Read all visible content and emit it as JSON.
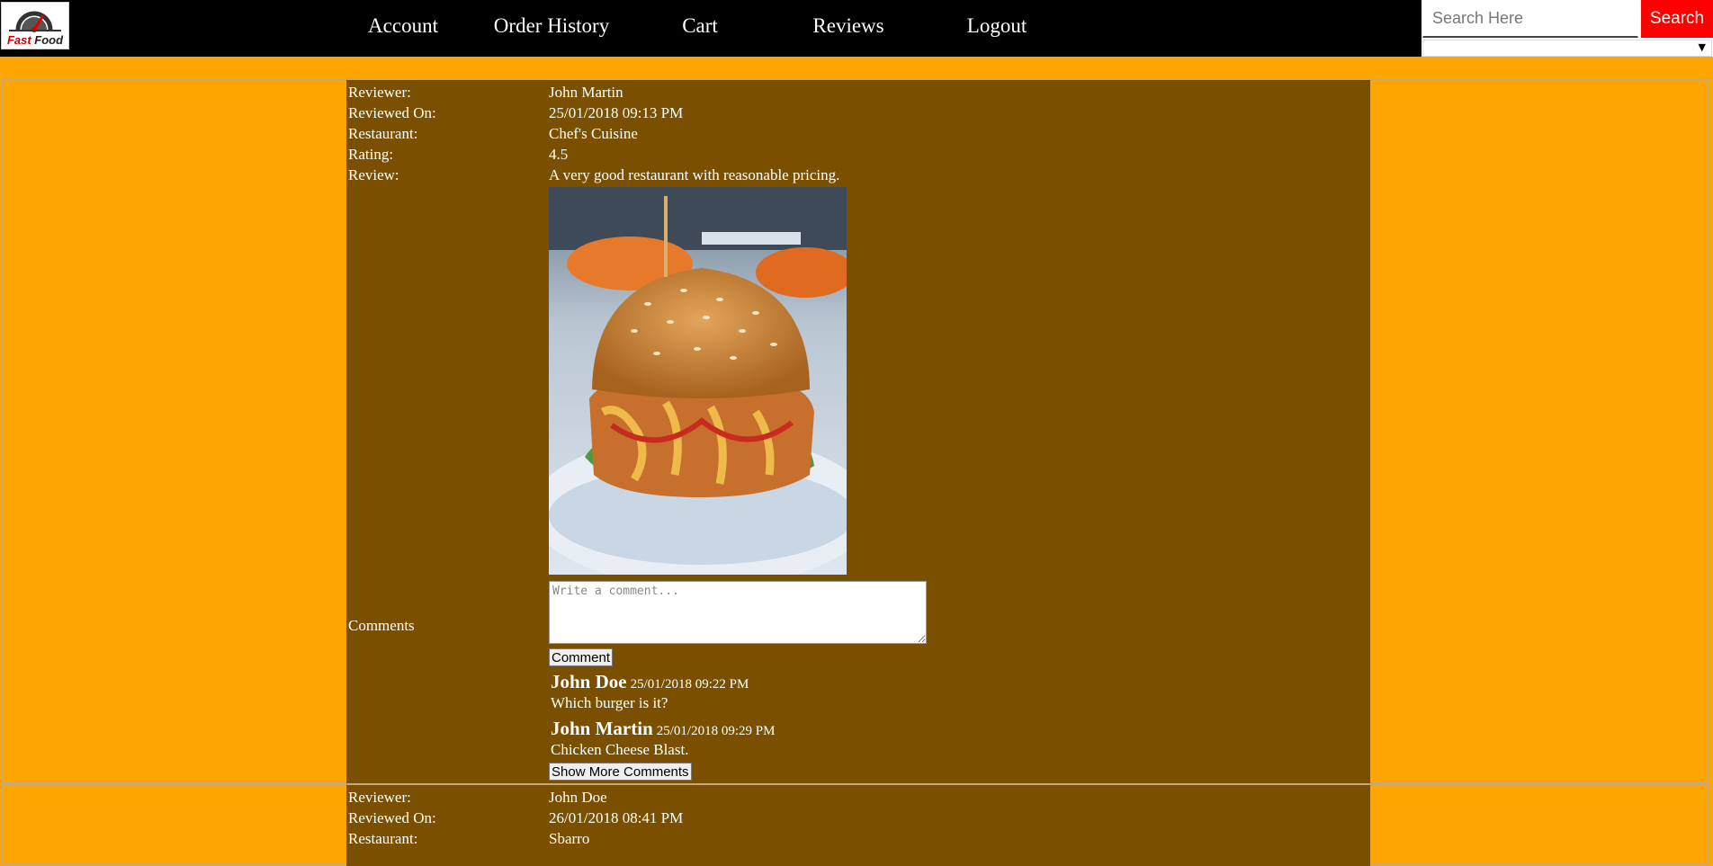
{
  "nav": {
    "logo_text": "Fast Food",
    "links": [
      "Account",
      "Order History",
      "Cart",
      "Reviews",
      "Logout"
    ],
    "search_placeholder": "Search Here",
    "search_button": "Search"
  },
  "labels": {
    "reviewer": "Reviewer:",
    "reviewed_on": "Reviewed On:",
    "restaurant": "Restaurant:",
    "rating": "Rating:",
    "review": "Review:",
    "comments": "Comments",
    "comment_placeholder": "Write a comment...",
    "comment_button": "Comment",
    "show_more_button": "Show More Comments"
  },
  "reviews": [
    {
      "reviewer": "John Martin",
      "reviewed_on": "25/01/2018 09:13 PM",
      "restaurant": "Chef's Cuisine",
      "rating": "4.5",
      "review": "A very good restaurant with reasonable pricing.",
      "comments": [
        {
          "author": "John Doe",
          "date": "25/01/2018 09:22 PM",
          "text": "Which burger is it?"
        },
        {
          "author": "John Martin",
          "date": "25/01/2018 09:29 PM",
          "text": "Chicken Cheese Blast."
        }
      ]
    },
    {
      "reviewer": "John Doe",
      "reviewed_on": "26/01/2018 08:41 PM",
      "restaurant": "Sbarro"
    }
  ]
}
